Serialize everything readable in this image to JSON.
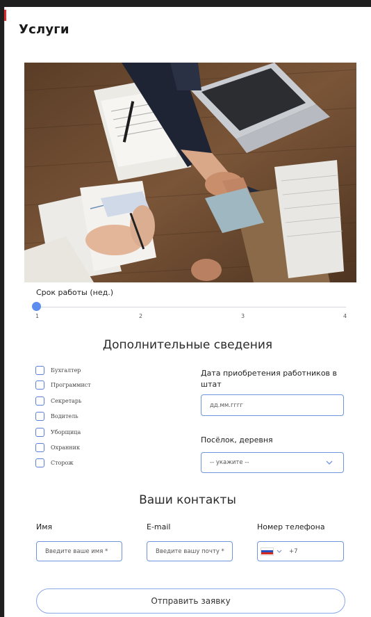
{
  "header": {
    "title": "Услуги"
  },
  "hero": {
    "alt_theme": "handshake-over-desk"
  },
  "slider": {
    "label": "Срок работы (нед.)",
    "ticks": [
      "1",
      "2",
      "3",
      "4"
    ],
    "value": 1,
    "min": 1,
    "max": 4,
    "accent": "#5b8def"
  },
  "extra": {
    "title": "Дополнительные сведения",
    "checkboxes": [
      "Бухгалтер",
      "Программист",
      "Секретарь",
      "Водитель",
      "Уборщица",
      "Охранник",
      "Сторож"
    ],
    "date_label": "Дата приобретения работников в штат",
    "date_placeholder": "дд.мм.гггг",
    "settlement_label": "Посёлок, деревня",
    "settlement_value": "-- укажите --"
  },
  "contacts": {
    "title": "Ваши контакты",
    "name_label": "Имя",
    "name_placeholder": "Введите ваше имя *",
    "email_label": "E-mail",
    "email_placeholder": "Введите вашу почту *",
    "phone_label": "Номер телефона",
    "phone_prefix": "+7",
    "flag": "russia-flag"
  },
  "submit": {
    "label": "Отправить заявку"
  },
  "colors": {
    "accent": "#5b8def",
    "border": "#6f95e0",
    "frame": "#1f1f1f",
    "marker": "#e12a2a"
  }
}
